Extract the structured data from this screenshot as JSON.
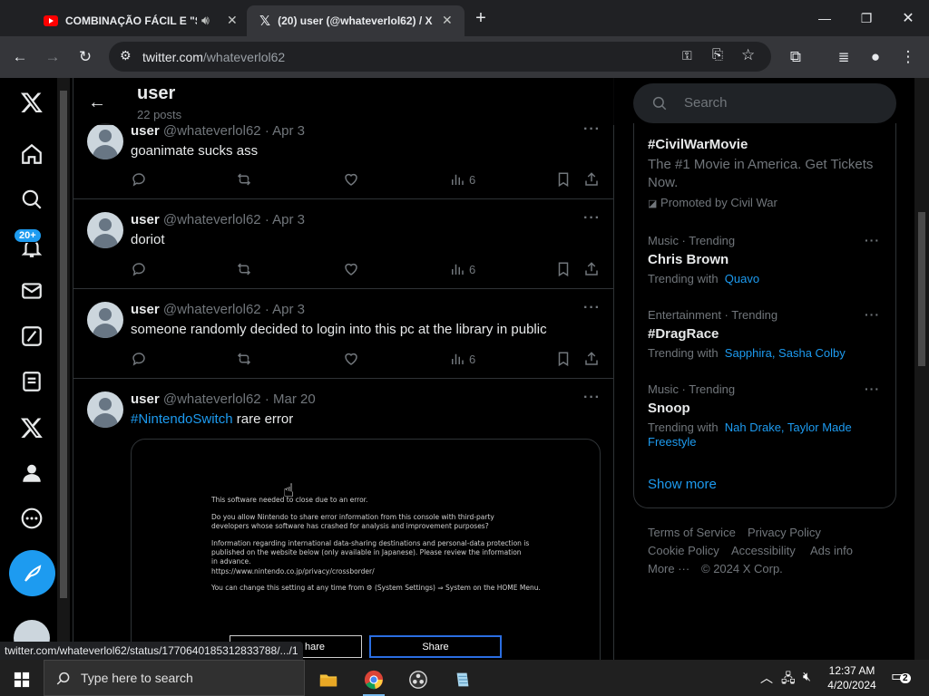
{
  "browser": {
    "tabs": [
      {
        "title": "COMBINAÇÃO FÁCIL E \"SA",
        "active": false,
        "audio": true
      },
      {
        "title": "(20) user (@whateverlol62) / X",
        "active": true
      }
    ],
    "url_domain": "twitter.com",
    "url_path": "/whateverlol62",
    "status_url": "twitter.com/whateverlol62/status/1770640185312833788/.../1"
  },
  "nav": {
    "notification_badge": "20+"
  },
  "profile_header": {
    "name": "user",
    "posts_count": "22 posts"
  },
  "tweets": [
    {
      "name": "user",
      "handle": "@whateverlol62",
      "date": "Apr 3",
      "text": "goanimate sucks ass",
      "views": "6"
    },
    {
      "name": "user",
      "handle": "@whateverlol62",
      "date": "Apr 3",
      "text": "doriot",
      "views": "6"
    },
    {
      "name": "user",
      "handle": "@whateverlol62",
      "date": "Apr 3",
      "text": "someone randomly decided to login into this pc at the library in public",
      "views": "6"
    },
    {
      "name": "user",
      "handle": "@whateverlol62",
      "date": "Mar 20",
      "hashtag": "#NintendoSwitch",
      "text": "rare error"
    }
  ],
  "media": {
    "error_lines": [
      "This software needed to close due to an error.",
      "Do you allow Nintendo to share error information from this console with third-party",
      "developers whose software has crashed for analysis and improvement purposes?",
      "Information regarding international data-sharing destinations and personal-data protection is",
      "published on the website below (only available in Japanese). Please review the information",
      "in advance.",
      "https://www.nintendo.co.jp/privacy/crossborder/",
      "You can change this setting at any time from ⚙ (System Settings) ⇒ System on the HOME Menu."
    ],
    "button_left": "hare",
    "button_right": "Share"
  },
  "search": {
    "placeholder": "Search"
  },
  "trends": [
    {
      "title": "#CivilWarMovie",
      "description": "The #1 Movie in America. Get Tickets Now.",
      "promoted": "Promoted by Civil War"
    },
    {
      "meta": "Music · Trending",
      "title": "Chris Brown",
      "with_label": "Trending with",
      "with_links": "Quavo"
    },
    {
      "meta": "Entertainment · Trending",
      "title": "#DragRace",
      "with_label": "Trending with",
      "with_links": "Sapphira, Sasha Colby"
    },
    {
      "meta": "Music · Trending",
      "title": "Snoop",
      "with_label": "Trending with",
      "with_links": "Nah Drake, Taylor Made Freestyle"
    }
  ],
  "show_more": "Show more",
  "footer": {
    "terms": "Terms of Service",
    "privacy": "Privacy Policy",
    "cookie": "Cookie Policy",
    "accessibility": "Accessibility",
    "ads": "Ads info",
    "more": "More ···",
    "copyright": "© 2024 X Corp."
  },
  "taskbar": {
    "search_placeholder": "Type here to search",
    "time": "12:37 AM",
    "date": "4/20/2024",
    "notification_count": "2"
  },
  "colors": {
    "accent": "#1d9bf0",
    "background": "#000000",
    "muted_text": "#71767b",
    "border": "#2f3336"
  }
}
